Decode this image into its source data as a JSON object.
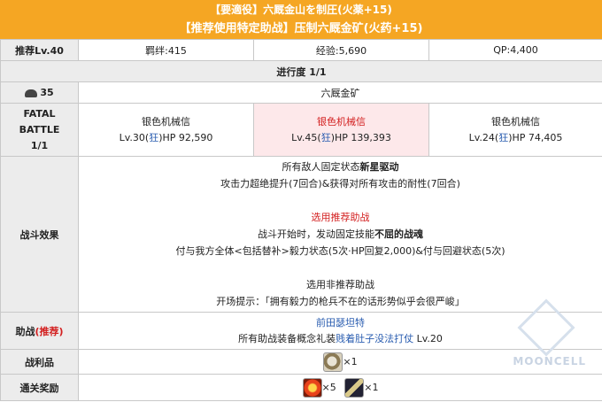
{
  "banner": {
    "line1": "【要適役】六厩金山を制圧(火薬+15)",
    "line2": "【推荐使用特定助战】压制六厩金矿(火药+15)"
  },
  "info": {
    "level_label": "推荐Lv.40",
    "bond": "羁绊:415",
    "exp": "经验:5,690",
    "qp": "QP:4,400"
  },
  "progress": "进行度 1/1",
  "location": {
    "ap": "35",
    "name": "六厩金矿"
  },
  "battle": {
    "label_line1": "FATAL",
    "label_line2": "BATTLE",
    "label_line3": "1/1",
    "enemies": [
      {
        "name": "银色机械信",
        "level": "Lv.30",
        "class": "狂",
        "hp": "HP 92,590"
      },
      {
        "name": "银色机械信",
        "level": "Lv.45",
        "class": "狂",
        "hp": "HP 139,393"
      },
      {
        "name": "银色机械信",
        "level": "Lv.24",
        "class": "狂",
        "hp": "HP 74,405"
      }
    ]
  },
  "effects": {
    "label": "战斗效果",
    "l1_pre": "所有敌人固定状态",
    "l1_bold": "新星驱动",
    "l2": "攻击力超绝提升(7回合)&获得对所有攻击的耐性(7回合)",
    "recommended_title": "选用推荐助战",
    "l4_pre": "战斗开始时，发动固定技能",
    "l4_bold": "不屈的战魂",
    "l5": "付与我方全体<包括替补>毅力状态(5次·HP回复2,000)&付与回避状态(5次)",
    "nonrec_title": "选用非推荐助战",
    "l7": "开场提示：「拥有毅力的枪兵不在的话形势似乎会很严峻」"
  },
  "support": {
    "label": "助战",
    "label_tag": "(推荐)",
    "servant": "前田瑟坦特",
    "ce_pre": "所有助战装备概念礼装",
    "ce_name": "贱着肚子没法打仗",
    "ce_level": "Lv.20"
  },
  "drops": {
    "label": "战利品",
    "count": "×1"
  },
  "rewards": {
    "label": "通关奖励",
    "count1": "×5",
    "count2": "×1"
  },
  "watermark": "MOONCELL"
}
